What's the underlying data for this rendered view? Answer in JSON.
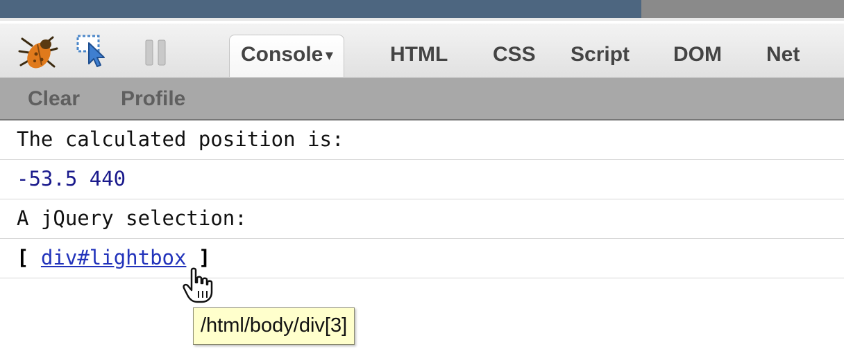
{
  "toolbar": {
    "tabs": [
      {
        "label": "Console",
        "active": true,
        "has_dropdown": true
      },
      {
        "label": "HTML"
      },
      {
        "label": "CSS"
      },
      {
        "label": "Script"
      },
      {
        "label": "DOM"
      },
      {
        "label": "Net"
      }
    ],
    "caret": "▾",
    "icons": [
      "firebug-bug-icon",
      "inspect-pointer-icon",
      "pause-icon"
    ]
  },
  "subbar": {
    "clear_label": "Clear",
    "profile_label": "Profile"
  },
  "console": {
    "lines": [
      "The calculated position is:",
      "-53.5 440",
      "A jQuery selection:"
    ],
    "selection": {
      "open_bracket": "[",
      "link_text": "div#lightbox",
      "close_bracket": "]"
    }
  },
  "tooltip": {
    "text": "/html/body/div[3]"
  },
  "colors": {
    "titlebar": "#4d6680",
    "subbar": "#a8a8a8",
    "link": "#2233bb",
    "number": "#1a1a8c",
    "tooltip_bg": "#ffffcc"
  }
}
